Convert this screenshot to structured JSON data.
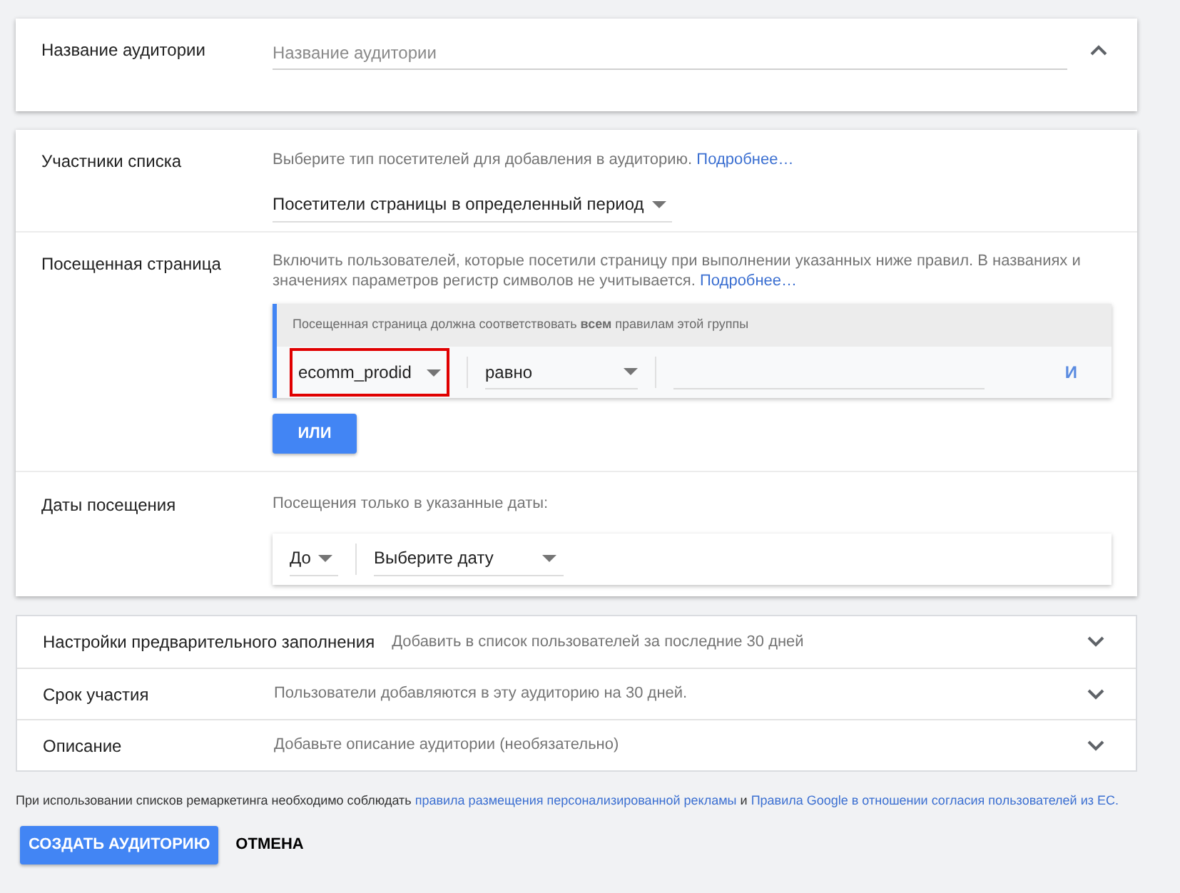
{
  "audience_name": {
    "label": "Название аудитории",
    "placeholder": "Название аудитории",
    "expanded": true
  },
  "list_members": {
    "label": "Участники списка",
    "description": "Выберите тип посетителей для добавления в аудиторию.",
    "link": "Подробнее…",
    "dropdown": "Посетители страницы в определенный период"
  },
  "visited_page": {
    "label": "Посещенная страница",
    "description": "Включить пользователей, которые посетили страницу при выполнении указанных ниже правил. В названиях и значениях параметров регистр символов не учитывается.",
    "link": "Подробнее…",
    "group": {
      "header": "Посещенная страница должна соответствовать **всем** правилам этой группы",
      "rules": [
        {
          "parameter": "ecomm_prodid",
          "highlighted": true,
          "operator": "равно",
          "and_button": "И"
        }
      ]
    },
    "or_button": "ИЛИ"
  },
  "visit_dates": {
    "label": "Даты посещения",
    "description": "Посещения только в указанные даты:",
    "range": "До",
    "date": "Выберите дату"
  },
  "collapsed_sections": [
    {
      "label": "Настройки предварительного заполнения",
      "summary": "Добавить в список пользователей за последние 30 дней",
      "expanded": false
    },
    {
      "label": "Срок участия",
      "summary": "Пользователи добавляются в эту аудиторию на 30 дней.",
      "expanded": false
    },
    {
      "label": "Описание",
      "summary": "Добавьте описание аудитории (необязательно)",
      "expanded": false
    }
  ],
  "footer": {
    "text_before": "При использовании списков ремаркетинга необходимо соблюдать",
    "link_1": "правила размещения персонализированной рекламы",
    "text_middle": "и",
    "link_2": "Правила Google в отношении согласия пользователей из ЕС."
  },
  "buttons": [
    {
      "label": "СОЗДАТЬ АУДИТОРИЮ",
      "kind": "primary"
    },
    {
      "label": "ОТМЕНА",
      "kind": "text"
    }
  ]
}
